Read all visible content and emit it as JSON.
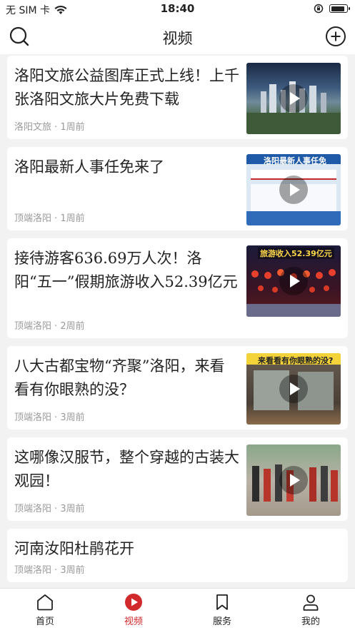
{
  "status": {
    "carrier": "无 SIM 卡",
    "time": "18:40"
  },
  "header": {
    "title": "视频"
  },
  "articles": [
    {
      "title": "洛阳文旅公益图库正式上线！上千张洛阳文旅大片免费下载",
      "meta": "洛阳文旅 · 1周前"
    },
    {
      "title": "洛阳最新人事任免来了",
      "meta": "顶端洛阳 · 1周前",
      "thumb_text": "洛阳最新人事任免"
    },
    {
      "title": "接待游客636.69万人次！洛阳“五一”假期旅游收入52.39亿元",
      "meta": "顶端洛阳 · 2周前",
      "thumb_text": "旅游收入52.39亿元"
    },
    {
      "title": "八大古都宝物“齐聚”洛阳，来看看有你眼熟的没？",
      "meta": "顶端洛阳 · 3周前",
      "thumb_text": "来看看有你眼熟的没?"
    },
    {
      "title": "这哪像汉服节，整个穿越的古装大观园！",
      "meta": "顶端洛阳 · 3周前"
    },
    {
      "title": "河南汝阳杜鹃花开",
      "meta": "顶端洛阳 · 3周前"
    }
  ],
  "tabs": [
    {
      "label": "首页",
      "icon": "home-icon"
    },
    {
      "label": "视频",
      "icon": "video-play-icon"
    },
    {
      "label": "服务",
      "icon": "bookmark-icon"
    },
    {
      "label": "我的",
      "icon": "profile-icon"
    }
  ],
  "active_tab": "视频",
  "colors": {
    "accent": "#d2292d",
    "background": "#f2f2f2",
    "meta_text": "#9a9a9a"
  }
}
